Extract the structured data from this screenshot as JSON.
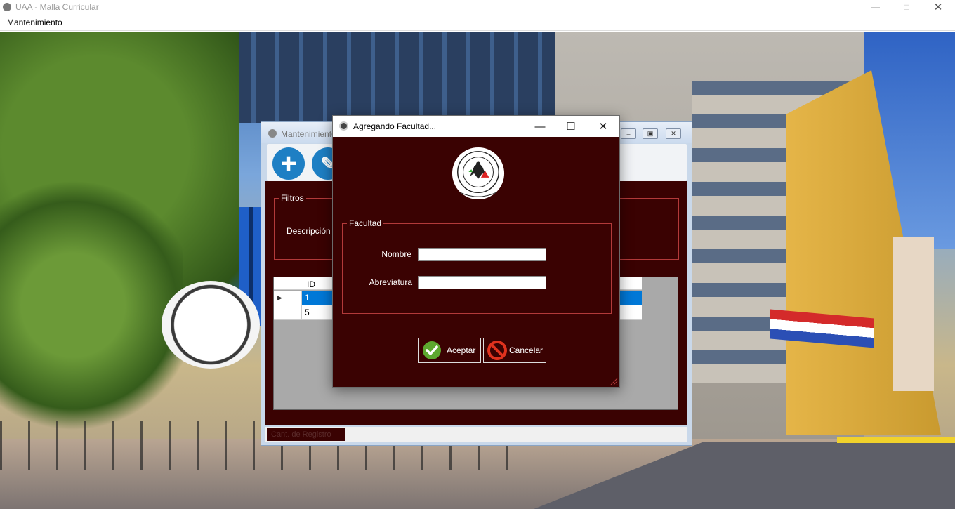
{
  "app": {
    "title": "UAA - Malla Curricular",
    "menu": [
      "Mantenimiento"
    ]
  },
  "child_window": {
    "title": "Mantenimiento",
    "filtros_label": "Filtros",
    "descripcion_label": "Descripción",
    "grid": {
      "columns": [
        "ID"
      ],
      "rows": [
        {
          "id": "1",
          "selected": true
        },
        {
          "id": "5",
          "selected": false
        }
      ]
    },
    "status_label": "Cant. de Registro"
  },
  "dialog": {
    "title": "Agregando Facultad...",
    "group_label": "Facultad",
    "fields": {
      "nombre": {
        "label": "Nombre",
        "value": ""
      },
      "abreviatura": {
        "label": "Abreviatura",
        "value": ""
      }
    },
    "buttons": {
      "accept": "Aceptar",
      "cancel": "Cancelar"
    }
  },
  "colors": {
    "form_bg": "#3a0202",
    "group_border": "#b33a3a",
    "selection": "#0078d7",
    "tool_blue": "#1e7fc4"
  }
}
